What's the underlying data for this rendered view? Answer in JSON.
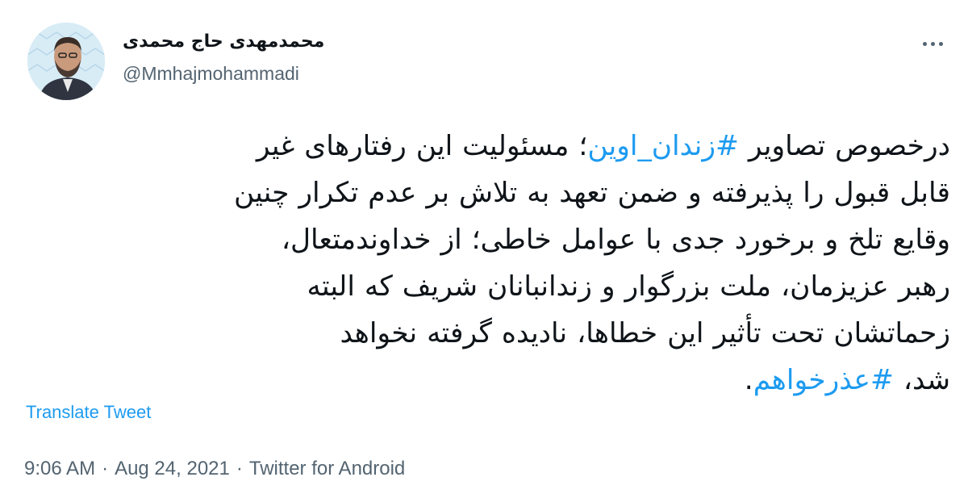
{
  "author": {
    "display_name": "محمدمهدی حاج محمدی",
    "handle": "@Mmhajmohammadi",
    "avatar_icon": "user-avatar-photo"
  },
  "more_icon": "more-horizontal-icon",
  "tweet": {
    "lines": [
      {
        "before": "درخصوص تصاویر ",
        "hashtag": "#زندان_اوین",
        "after": "؛ مسئولیت این رفتارهای غیر"
      },
      {
        "text": "قابل قبول را پذیرفته و ضمن تعهد به تلاش بر عدم تکرار چنین"
      },
      {
        "text": "وقایع تلخ و برخورد جدی با عوامل خاطی؛ از خداوندمتعال،"
      },
      {
        "text": "رهبر عزیزمان، ملت بزرگوار و زندانبانان شریف که البته"
      },
      {
        "text": "زحماتشان تحت تأثیر این خطاها، نادیده گرفته نخواهد"
      },
      {
        "before": "شد، ",
        "hashtag": "#عذرخواهم",
        "after": "."
      }
    ]
  },
  "translate_label": "Translate Tweet",
  "meta": {
    "time": "9:06 AM",
    "date": "Aug 24, 2021",
    "source": "Twitter for Android",
    "separator": "·"
  },
  "colors": {
    "link": "#1d9bf0",
    "text": "#0f1419",
    "secondary": "#536471"
  }
}
